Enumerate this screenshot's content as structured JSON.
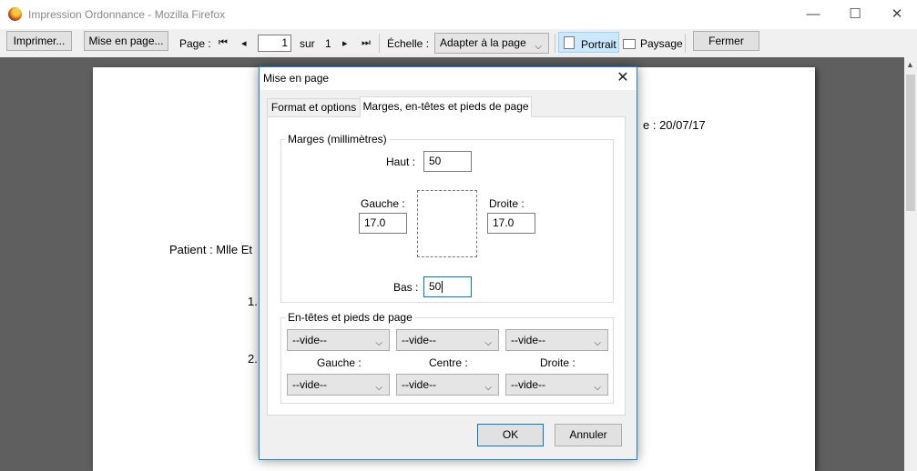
{
  "window": {
    "title": "Impression Ordonnance - Mozilla Firefox",
    "minimize": "—",
    "maximize": "☐",
    "close": "✕"
  },
  "toolbar": {
    "print_label": "Imprimer...",
    "page_setup_label": "Mise en page...",
    "page_label": "Page :",
    "page_value": "1",
    "of_label": "sur",
    "page_total": "1",
    "scale_label": "Échelle :",
    "scale_value": "Adapter à la page",
    "portrait_label": "Portrait",
    "landscape_label": "Paysage",
    "close_label": "Fermer"
  },
  "document": {
    "date_fragment": "e : 20/07/17",
    "patient_fragment": "Patient : Mlle Et",
    "item1": "1.",
    "item2": "2."
  },
  "dialog": {
    "title": "Mise en page",
    "close": "✕",
    "tabs": [
      {
        "label": "Format et options",
        "active": false
      },
      {
        "label": "Marges, en-têtes et pieds de page",
        "active": true
      }
    ],
    "margins": {
      "group_label": "Marges (millimètres)",
      "top_label": "Haut :",
      "top_value": "50",
      "left_label": "Gauche :",
      "left_value": "17.0",
      "right_label": "Droite :",
      "right_value": "17.0",
      "bottom_label": "Bas :",
      "bottom_value": "50"
    },
    "headers_footers": {
      "group_label": "En-têtes et pieds de page",
      "header_left": "--vide--",
      "header_center": "--vide--",
      "header_right": "--vide--",
      "left_label": "Gauche :",
      "center_label": "Centre :",
      "right_label": "Droite :",
      "footer_left": "--vide--",
      "footer_center": "--vide--",
      "footer_right": "--vide--"
    },
    "ok_label": "OK",
    "cancel_label": "Annuler"
  },
  "icons": {
    "first": "⏮",
    "prev": "◂",
    "next": "▸",
    "last": "⏭",
    "dropdown": "⌵"
  }
}
